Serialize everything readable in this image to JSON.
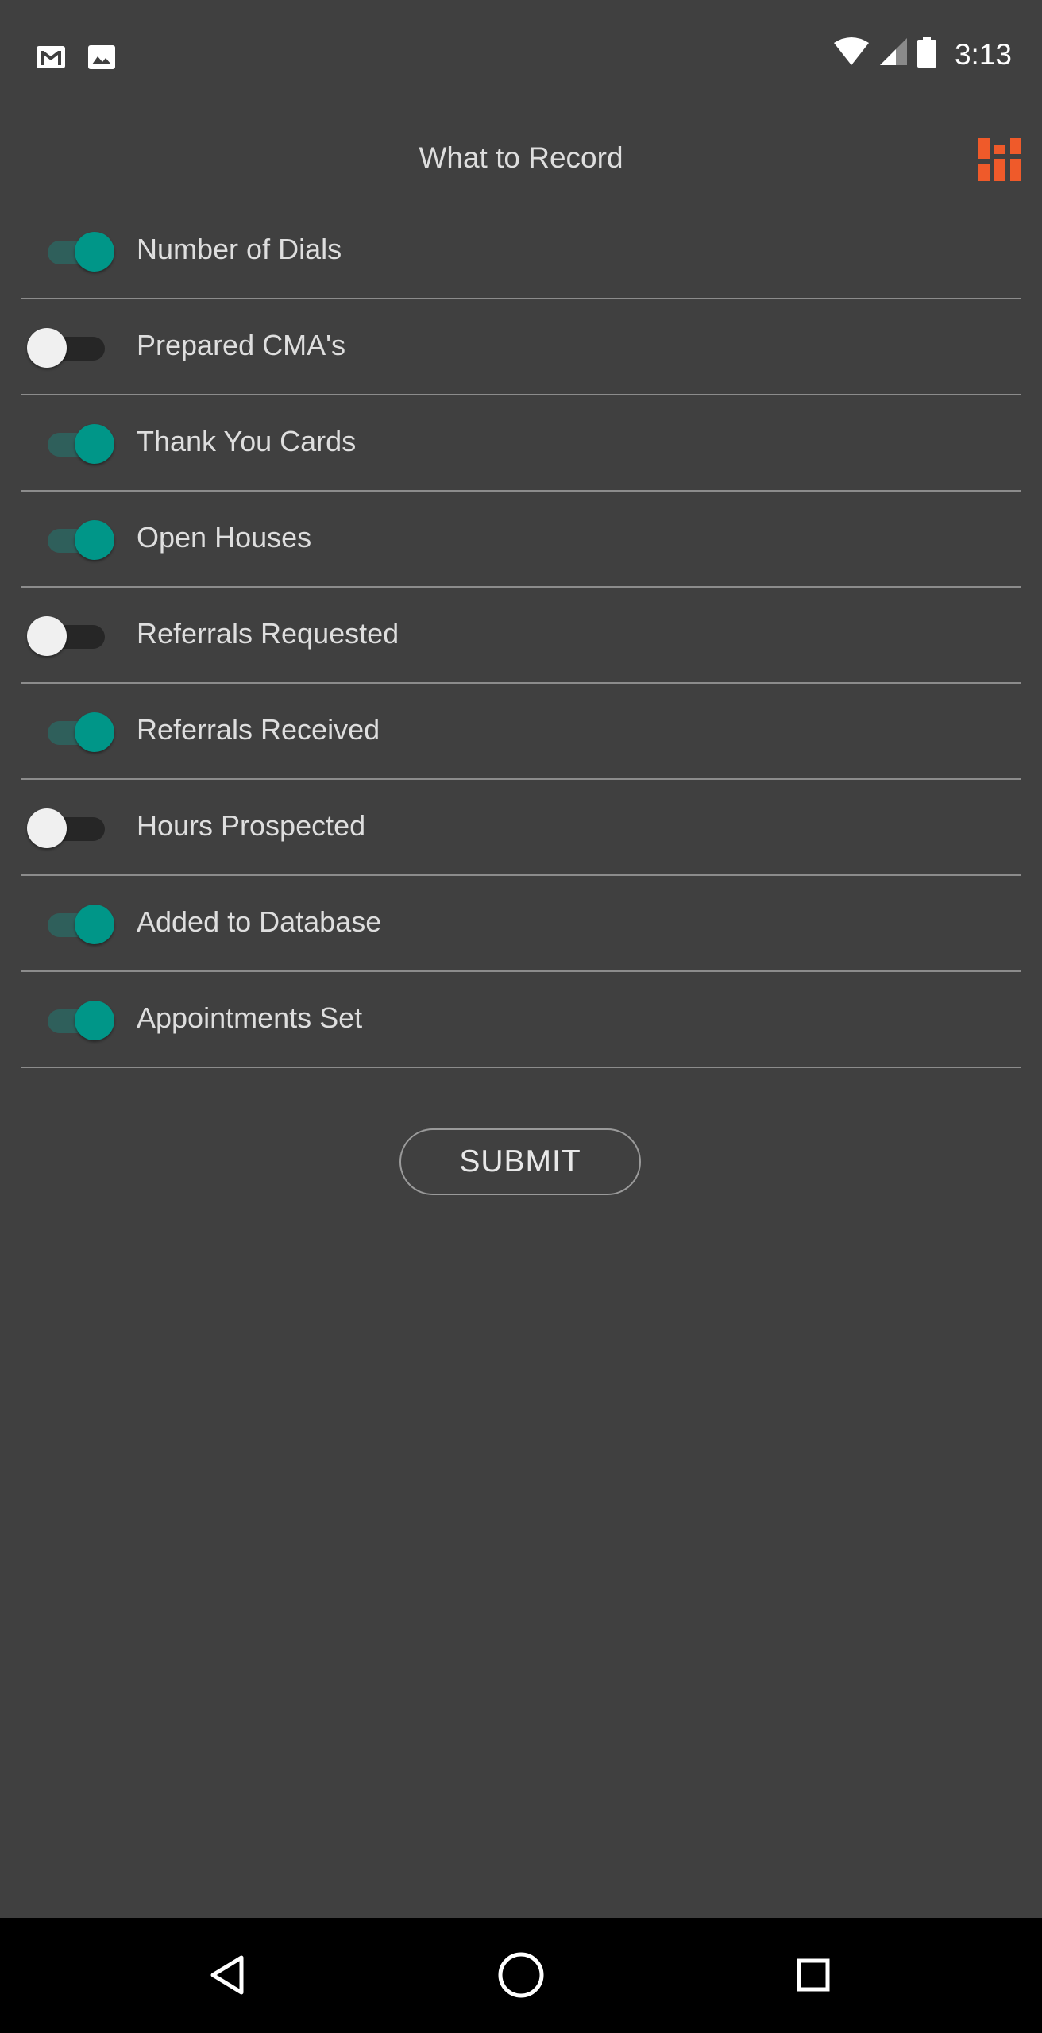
{
  "status_bar": {
    "time": "3:13",
    "left_icons": [
      "gmail-icon",
      "image-icon"
    ],
    "right_icons": [
      "wifi-icon",
      "cell-signal-icon",
      "battery-icon"
    ]
  },
  "header": {
    "title": "What to Record",
    "logo_icon": "app-logo-icon",
    "logo_color": "#ef5a2a"
  },
  "settings": [
    {
      "label": "Number of Dials",
      "enabled": true
    },
    {
      "label": "Prepared CMA's",
      "enabled": false
    },
    {
      "label": "Thank You Cards",
      "enabled": true
    },
    {
      "label": "Open Houses",
      "enabled": true
    },
    {
      "label": "Referrals Requested",
      "enabled": false
    },
    {
      "label": "Referrals Received",
      "enabled": true
    },
    {
      "label": "Hours Prospected",
      "enabled": false
    },
    {
      "label": "Added to Database",
      "enabled": true
    },
    {
      "label": "Appointments Set",
      "enabled": true
    }
  ],
  "submit_label": "SUBMIT",
  "nav_bar": {
    "icons": [
      "back-icon",
      "home-icon",
      "recents-icon"
    ]
  },
  "colors": {
    "background": "#404040",
    "toggle_on_thumb": "#009688",
    "toggle_on_track": "#2f5f5b",
    "toggle_off_thumb": "#f0f0f0",
    "toggle_off_track": "#262626",
    "divider": "#8c8c8c",
    "nav_bar": "#000000"
  }
}
